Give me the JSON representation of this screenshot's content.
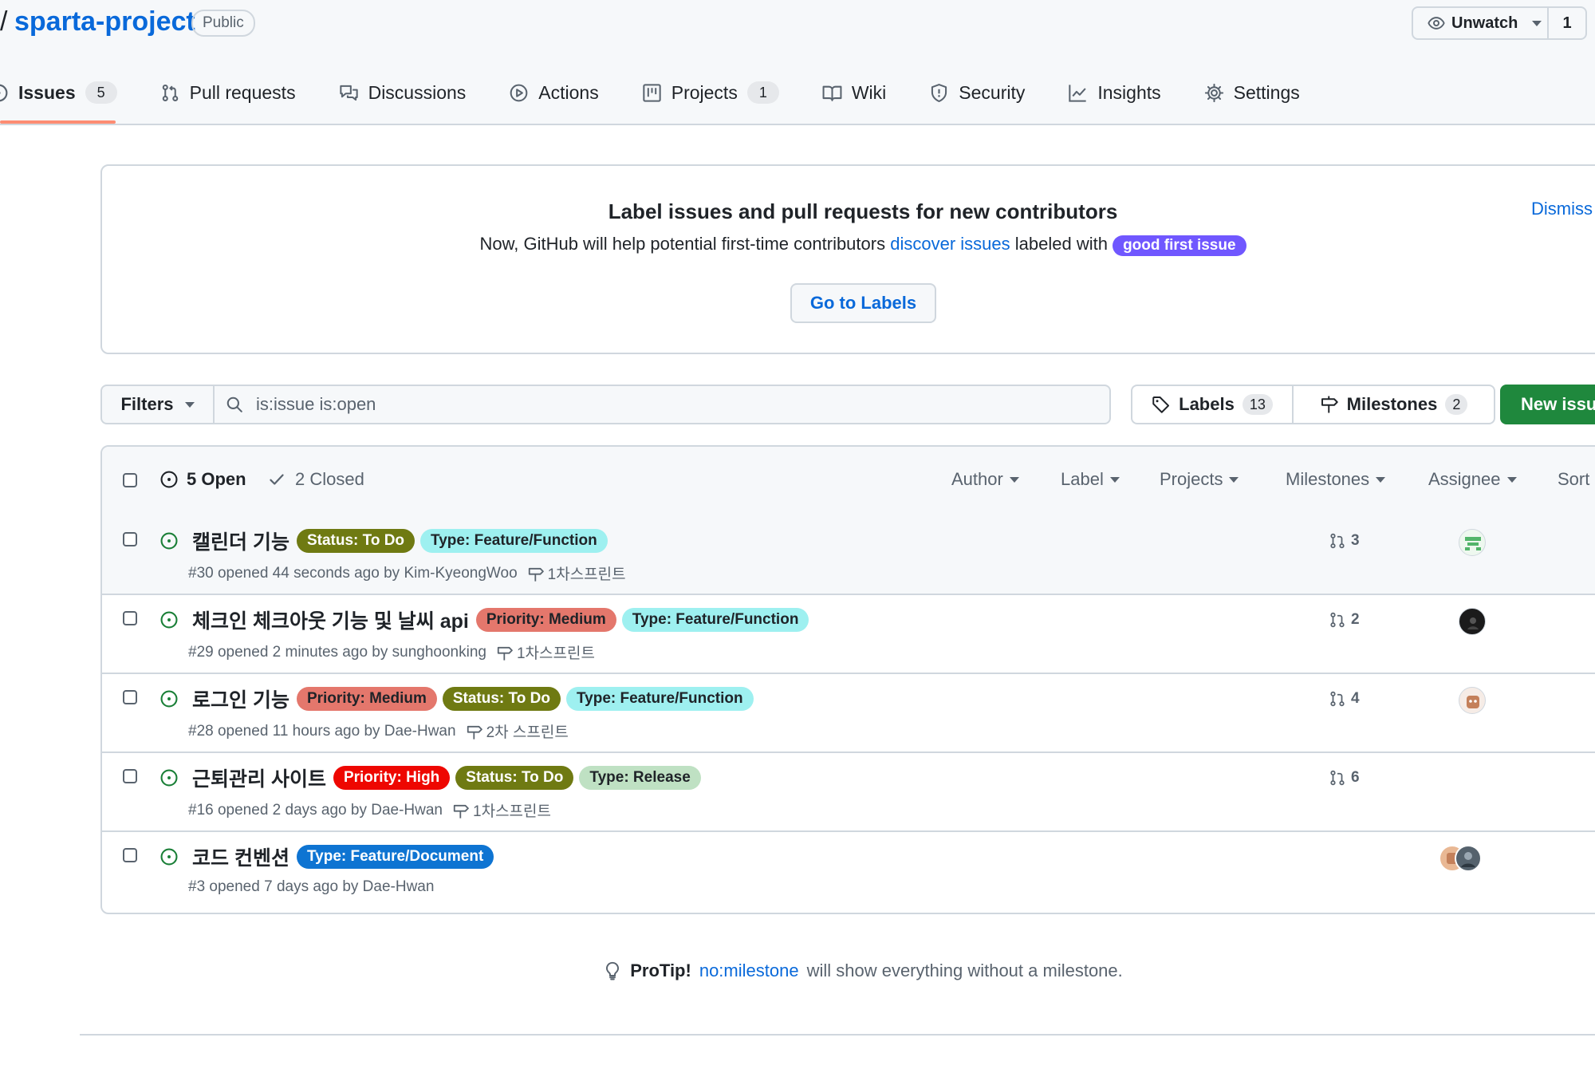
{
  "repo": {
    "slash": "/",
    "name": "sparta-project",
    "visibility": "Public"
  },
  "watch": {
    "label": "Unwatch",
    "count": "1"
  },
  "nav": [
    {
      "label": "Issues",
      "count": "5",
      "icon": "issue-opened-icon",
      "active": true
    },
    {
      "label": "Pull requests",
      "count": "",
      "icon": "git-pull-request-icon"
    },
    {
      "label": "Discussions",
      "count": "",
      "icon": "comment-discussion-icon"
    },
    {
      "label": "Actions",
      "count": "",
      "icon": "play-icon"
    },
    {
      "label": "Projects",
      "count": "1",
      "icon": "table-icon"
    },
    {
      "label": "Wiki",
      "count": "",
      "icon": "book-icon"
    },
    {
      "label": "Security",
      "count": "",
      "icon": "shield-icon"
    },
    {
      "label": "Insights",
      "count": "",
      "icon": "graph-icon"
    },
    {
      "label": "Settings",
      "count": "",
      "icon": "gear-icon"
    }
  ],
  "banner": {
    "title": "Label issues and pull requests for new contributors",
    "text_before": "Now, GitHub will help potential first-time contributors",
    "link": "discover issues",
    "text_after": "labeled with",
    "label": "good first issue",
    "label_color": "#7057ff",
    "dismiss": "Dismiss",
    "button": "Go to Labels"
  },
  "filters": {
    "button": "Filters",
    "query": "is:issue is:open",
    "labels_label": "Labels",
    "labels_count": "13",
    "milestones_label": "Milestones",
    "milestones_count": "2",
    "new_issue": "New issue"
  },
  "list_header": {
    "open": "5 Open",
    "closed": "2 Closed",
    "columns": [
      "Author",
      "Label",
      "Projects",
      "Milestones",
      "Assignee",
      "Sort"
    ]
  },
  "issues": [
    {
      "title": "캘린더 기능",
      "labels": [
        {
          "text": "Status: To Do",
          "bg": "#6f7a12",
          "fg": "#ffffff"
        },
        {
          "text": "Type: Feature/Function",
          "bg": "#9ef0f0",
          "fg": "#1f2328"
        }
      ],
      "meta": "#30 opened 44 seconds ago by Kim-KyeongWoo",
      "milestone": "1차스프린트",
      "pr_count": "3",
      "avatar": "green"
    },
    {
      "title": "체크인 체크아웃 기능 및 날씨 api",
      "labels": [
        {
          "text": "Priority: Medium",
          "bg": "#e4776c",
          "fg": "#1f2328"
        },
        {
          "text": "Type: Feature/Function",
          "bg": "#9ef0f0",
          "fg": "#1f2328"
        }
      ],
      "meta": "#29 opened 2 minutes ago by sunghoonking",
      "milestone": "1차스프린트",
      "pr_count": "2",
      "avatar": "dark"
    },
    {
      "title": "로그인 기능",
      "labels": [
        {
          "text": "Priority: Medium",
          "bg": "#e4776c",
          "fg": "#1f2328"
        },
        {
          "text": "Status: To Do",
          "bg": "#6f7a12",
          "fg": "#ffffff"
        },
        {
          "text": "Type: Feature/Function",
          "bg": "#9ef0f0",
          "fg": "#1f2328"
        }
      ],
      "meta": "#28 opened 11 hours ago by Dae-Hwan",
      "milestone": "2차 스프린트",
      "pr_count": "4",
      "avatar": "brown"
    },
    {
      "title": "근퇴관리 사이트",
      "labels": [
        {
          "text": "Priority: High",
          "bg": "#ee0701",
          "fg": "#ffffff"
        },
        {
          "text": "Status: To Do",
          "bg": "#6f7a12",
          "fg": "#ffffff"
        },
        {
          "text": "Type: Release",
          "bg": "#bfe1c3",
          "fg": "#1f2328"
        }
      ],
      "meta": "#16 opened 2 days ago by Dae-Hwan",
      "milestone": "1차스프린트",
      "pr_count": "6",
      "avatar": ""
    },
    {
      "title": "코드 컨벤션",
      "labels": [
        {
          "text": "Type: Feature/Document",
          "bg": "#0e74d2",
          "fg": "#ffffff"
        }
      ],
      "meta": "#3 opened 7 days ago by Dae-Hwan",
      "milestone": "",
      "pr_count": "",
      "avatar": "group"
    }
  ],
  "protip": {
    "label": "ProTip!",
    "link": "no:milestone",
    "text": "will show everything without a milestone."
  },
  "colors": {
    "accent": "#0969da",
    "open_issue": "#1a7f37",
    "new_issue_button": "#1f883d",
    "nav_underline": "#fd8c73"
  }
}
